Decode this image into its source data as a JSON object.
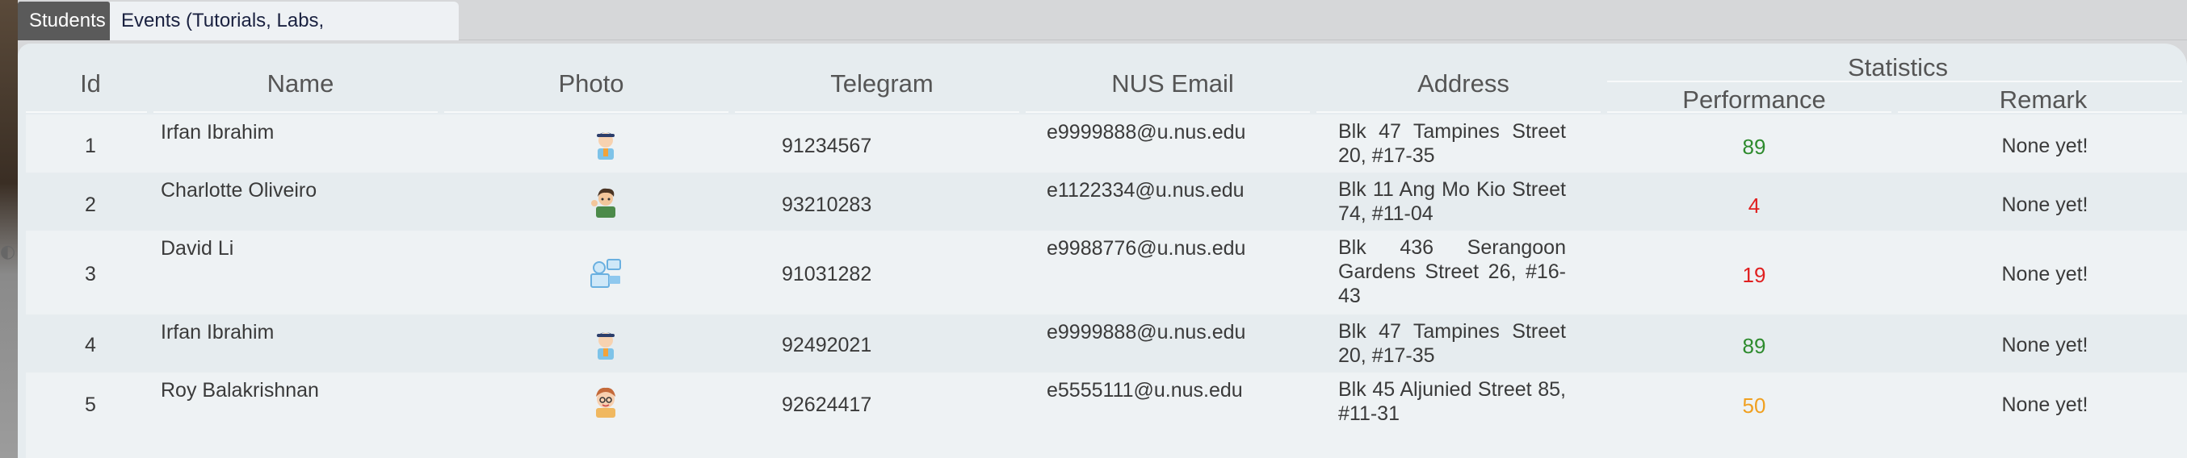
{
  "tabs": [
    {
      "label": "Students",
      "active": true
    },
    {
      "label": "Events (Tutorials, Labs, Consultations)",
      "active": false
    }
  ],
  "table": {
    "columns": {
      "id": "Id",
      "name": "Name",
      "photo": "Photo",
      "telegram": "Telegram",
      "email": "NUS Email",
      "address": "Address",
      "statistics": "Statistics",
      "performance": "Performance",
      "remark": "Remark"
    },
    "rows": [
      {
        "id": "1",
        "name": "Irfan Ibrahim",
        "avatar": "student-boy-icon",
        "telegram": "91234567",
        "email": "e9999888@u.nus.edu",
        "address": "Blk 47 Tampines Street 20, #17-35",
        "performance": "89",
        "performance_color": "#2e8b2e",
        "remark": "None yet!"
      },
      {
        "id": "2",
        "name": "Charlotte Oliveiro",
        "avatar": "student-waving-icon",
        "telegram": "93210283",
        "email": "e1122334@u.nus.edu",
        "address": "Blk 11 Ang Mo Kio Street 74, #11-04",
        "performance": "4",
        "performance_color": "#e02020",
        "remark": "None yet!"
      },
      {
        "id": "3",
        "name": "David Li",
        "avatar": "student-computer-icon",
        "telegram": "91031282",
        "email": "e9988776@u.nus.edu",
        "address": "Blk 436 Serangoon Gardens Street 26, #16-43",
        "performance": "19",
        "performance_color": "#e02020",
        "remark": "None yet!"
      },
      {
        "id": "4",
        "name": "Irfan Ibrahim",
        "avatar": "student-boy-icon",
        "telegram": "92492021",
        "email": "e9999888@u.nus.edu",
        "address": "Blk 47 Tampines Street 20, #17-35",
        "performance": "89",
        "performance_color": "#2e8b2e",
        "remark": "None yet!"
      },
      {
        "id": "5",
        "name": "Roy Balakrishnan",
        "avatar": "student-face-icon",
        "telegram": "92624417",
        "email": "e5555111@u.nus.edu",
        "address": "Blk 45 Aljunied Street 85, #11-31",
        "performance": "50",
        "performance_color": "#f0a020",
        "remark": "None yet!"
      }
    ]
  }
}
